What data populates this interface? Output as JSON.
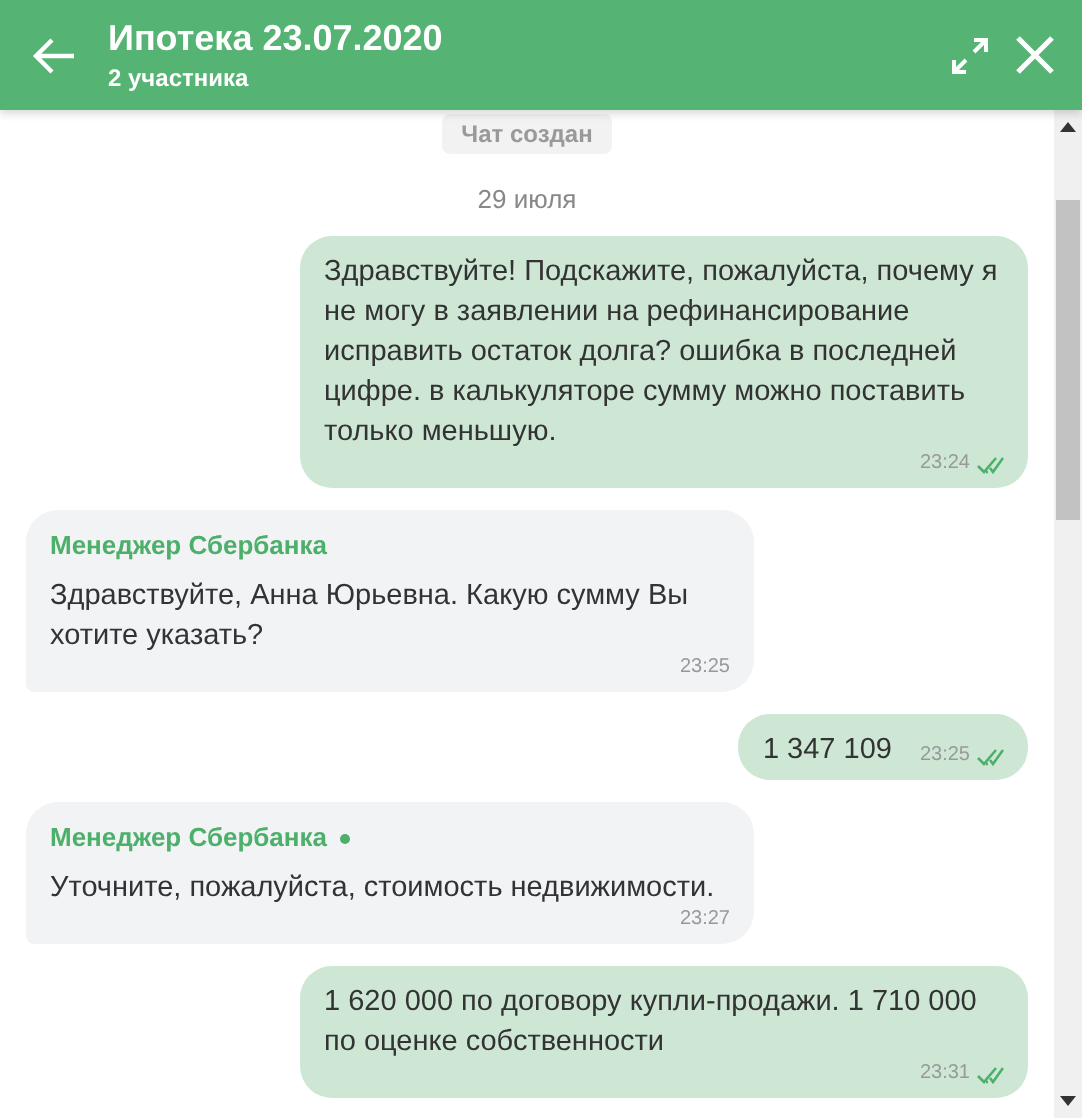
{
  "header": {
    "title": "Ипотека 23.07.2020",
    "subtitle": "2 участника"
  },
  "system_notice": "Чат создан",
  "date_divider": "29 июля",
  "messages": [
    {
      "kind": "outgoing",
      "text": "Здравствуйте! Подскажите, пожалуйста, почему я не могу в заявлении на рефинансирование исправить остаток долга? ошибка в последней цифре. в калькуляторе сумму можно поставить только меньшую.",
      "time": "23:24",
      "read": true
    },
    {
      "kind": "incoming",
      "sender": "Менеджер Сбербанка",
      "online": false,
      "text": "Здравствуйте, Анна Юрьевна. Какую сумму Вы хотите указать?",
      "time": "23:25"
    },
    {
      "kind": "outgoing",
      "text": "1 347 109",
      "time": "23:25",
      "read": true
    },
    {
      "kind": "incoming",
      "sender": "Менеджер Сбербанка",
      "online": true,
      "text": "Уточните, пожалуйста, стоимость недвижимости.",
      "time": "23:27"
    },
    {
      "kind": "outgoing",
      "text": "1 620 000 по договору купли-продажи. 1 710 000 по оценке собственности",
      "time": "23:31",
      "read": true
    }
  ]
}
